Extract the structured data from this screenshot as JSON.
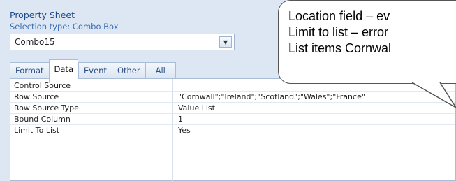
{
  "panel": {
    "title": "Property Sheet",
    "selection_type": "Selection type: Combo Box"
  },
  "object_selector": {
    "value": "Combo15",
    "dropdown_icon": "triangle-down"
  },
  "tabs": [
    {
      "label": "Format",
      "active": false
    },
    {
      "label": "Data",
      "active": true
    },
    {
      "label": "Event",
      "active": false
    },
    {
      "label": "Other",
      "active": false
    },
    {
      "label": "All",
      "active": false
    }
  ],
  "properties": [
    {
      "name": "Control Source",
      "value": ""
    },
    {
      "name": "Row Source",
      "value": "\"Cornwall\";\"Ireland\";\"Scotland\";\"Wales\";\"France\""
    },
    {
      "name": "Row Source Type",
      "value": "Value List"
    },
    {
      "name": "Bound Column",
      "value": "1"
    },
    {
      "name": "Limit To List",
      "value": "Yes"
    }
  ],
  "callout": {
    "line1": "Location field – ev",
    "line2": "Limit to list – error",
    "line3": "List items Cornwal"
  }
}
